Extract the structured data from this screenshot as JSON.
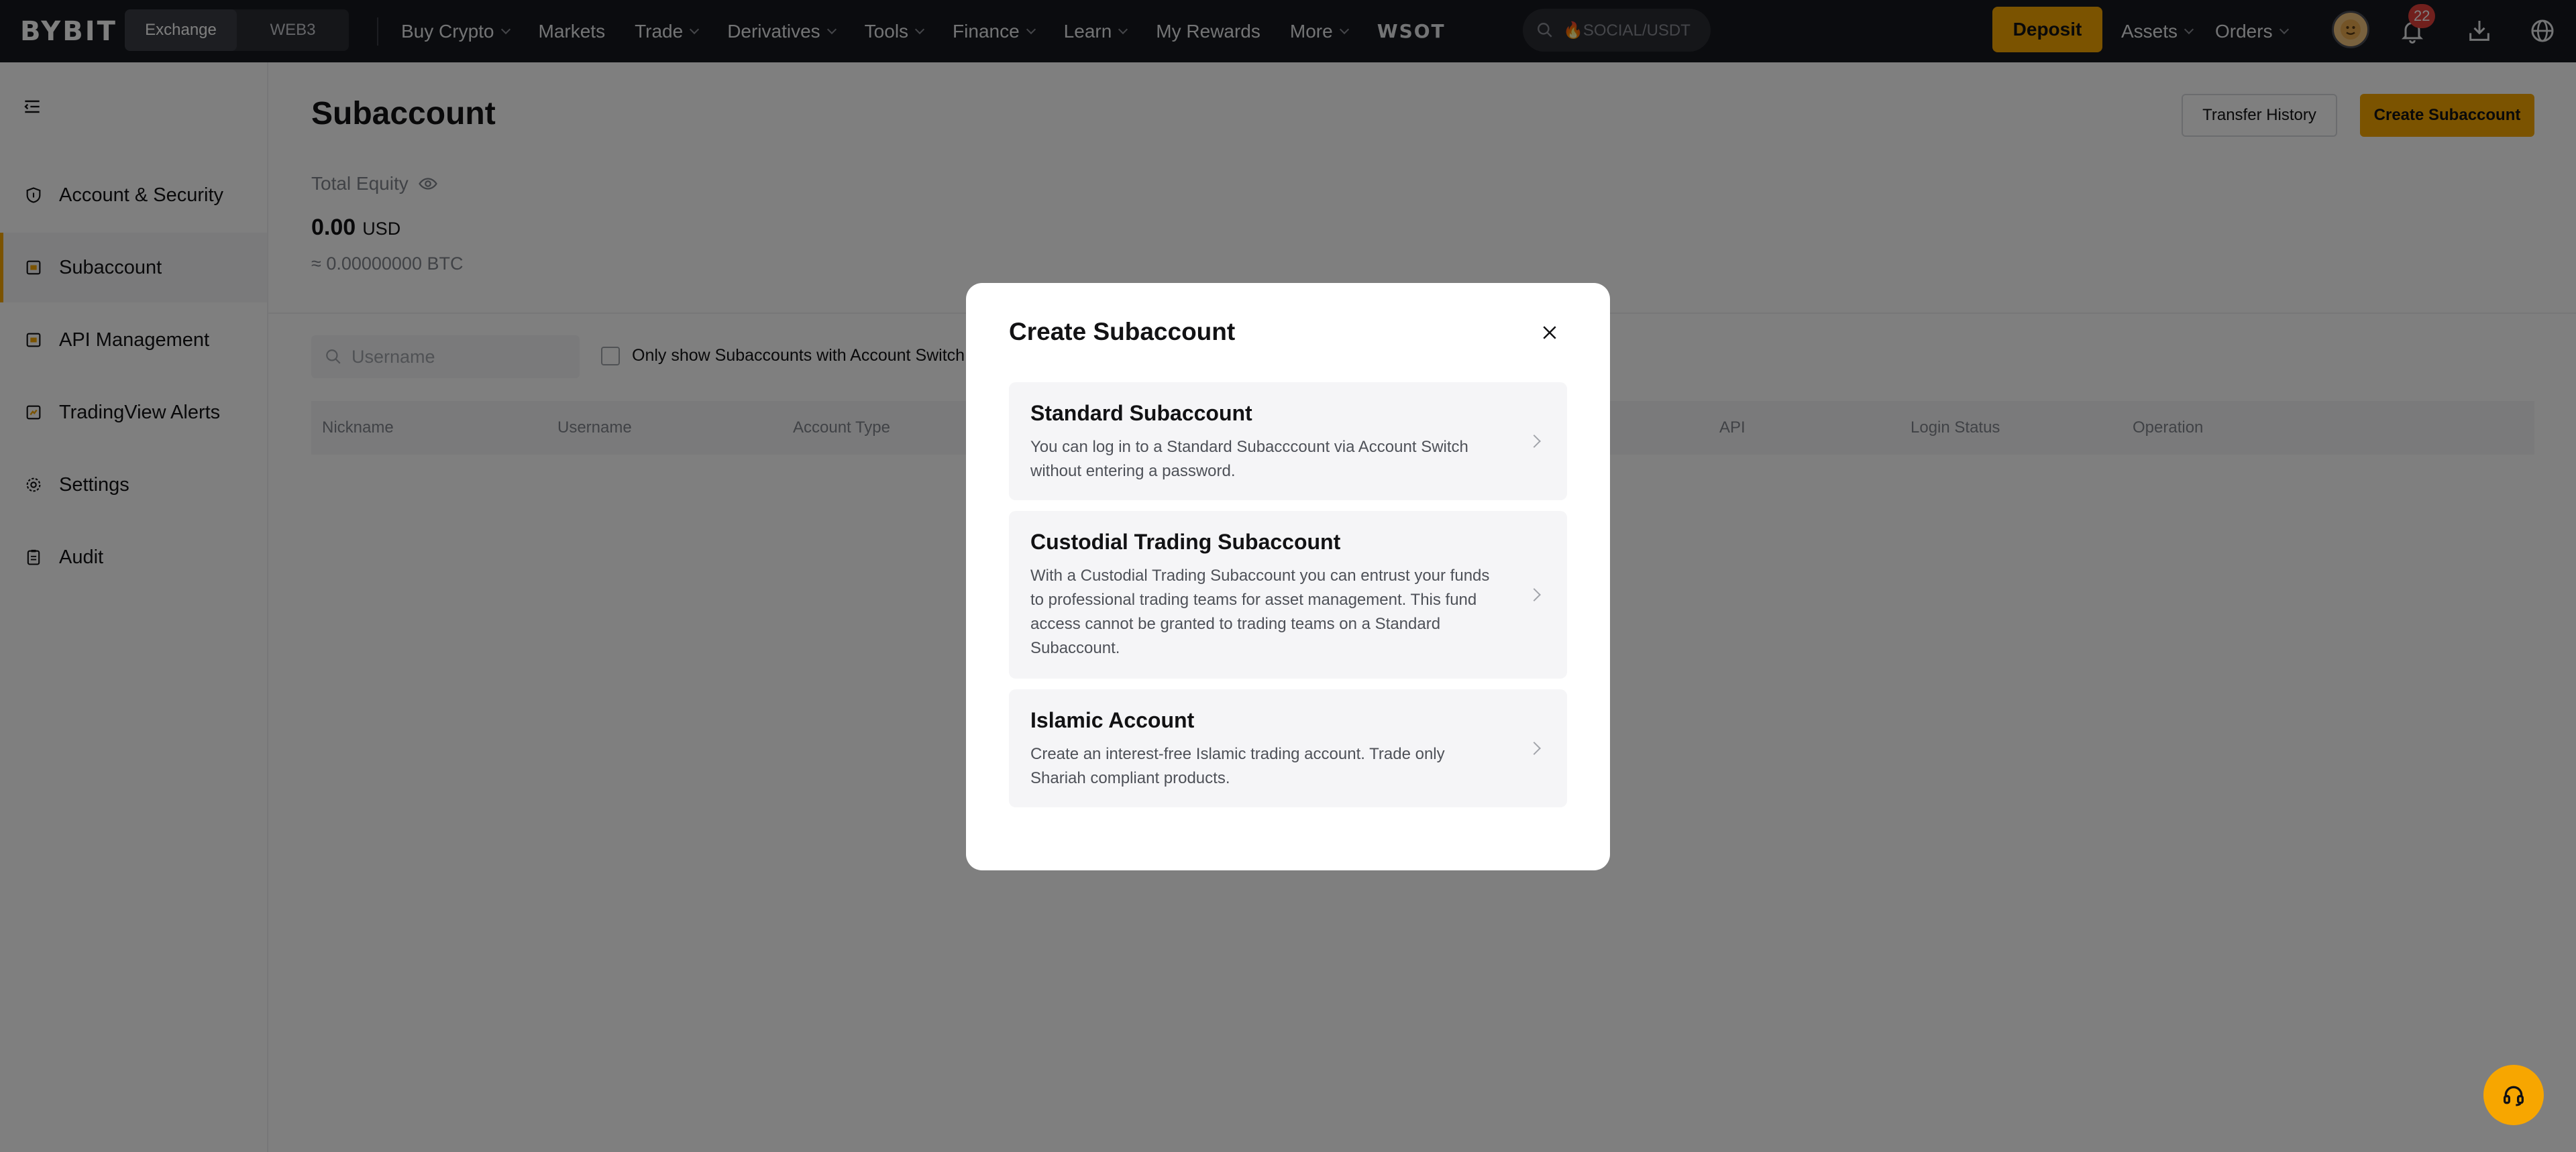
{
  "header": {
    "logo": "BYBIT",
    "switcher": [
      "Exchange",
      "WEB3"
    ],
    "menu": [
      {
        "label": "Buy Crypto"
      },
      {
        "label": "Markets"
      },
      {
        "label": "Trade"
      },
      {
        "label": "Derivatives"
      },
      {
        "label": "Tools"
      },
      {
        "label": "Finance"
      },
      {
        "label": "Learn"
      },
      {
        "label": "My Rewards"
      },
      {
        "label": "More"
      }
    ],
    "promo": "WSOT",
    "search_placeholder": "🔥SOCIAL/USDT",
    "deposit": "Deposit",
    "assets": "Assets",
    "orders": "Orders",
    "notification_count": "22"
  },
  "sidebar": {
    "items": [
      {
        "label": "Account & Security",
        "icon": "shield-icon"
      },
      {
        "label": "Subaccount",
        "icon": "subaccount-icon",
        "active": true
      },
      {
        "label": "API Management",
        "icon": "api-icon"
      },
      {
        "label": "TradingView Alerts",
        "icon": "alert-icon"
      },
      {
        "label": "Settings",
        "icon": "gear-icon"
      },
      {
        "label": "Audit",
        "icon": "clipboard-icon"
      }
    ]
  },
  "main": {
    "title": "Subaccount",
    "transfer_history": "Transfer History",
    "create_subaccount": "Create Subaccount",
    "total_equity_label": "Total Equity",
    "equity_value": "0.00",
    "equity_currency": "USD",
    "equity_btc": "≈ 0.00000000 BTC",
    "username_placeholder": "Username",
    "filter_checkbox_label": "Only show Subaccounts with Account Switch e",
    "table_headers": [
      "Nickname",
      "Username",
      "Account Type",
      "API",
      "Login Status",
      "Operation"
    ]
  },
  "modal": {
    "title": "Create Subaccount",
    "options": [
      {
        "title": "Standard Subaccount",
        "description": "You can log in to a Standard Subacccount via Account Switch without entering a password."
      },
      {
        "title": "Custodial Trading Subaccount",
        "description": "With a Custodial Trading Subaccount you can entrust your funds to professional trading teams for asset management. This fund access cannot be granted to trading teams on a Standard Subaccount."
      },
      {
        "title": "Islamic Account",
        "description": "Create an interest-free Islamic trading account. Trade only Shariah compliant products."
      }
    ]
  },
  "colors": {
    "accent": "#f7a600",
    "nav_background": "#17181e",
    "badge": "#e2403b",
    "overlay": "rgba(0,0,0,0.5)"
  }
}
